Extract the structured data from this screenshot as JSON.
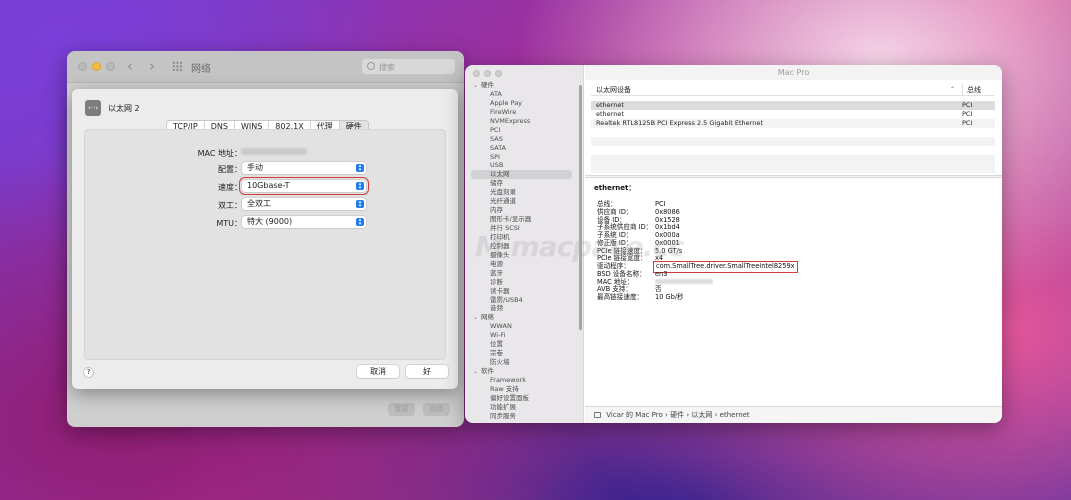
{
  "network_window": {
    "title": "网络",
    "search_placeholder": "搜索",
    "bottom_buttons": {
      "revert": "复原",
      "apply": "应用"
    }
  },
  "sheet": {
    "service_name": "以太网 2",
    "service_icon": "ethernet-arrows-icon",
    "tabs": [
      "TCP/IP",
      "DNS",
      "WINS",
      "802.1X",
      "代理",
      "硬件"
    ],
    "active_tab": "硬件",
    "fields": {
      "mac_label": "MAC 地址：",
      "config_label": "配置：",
      "config_value": "手动",
      "speed_label": "速度：",
      "speed_value": "10Gbase-T",
      "duplex_label": "双工：",
      "duplex_value": "全双工",
      "mtu_label": "MTU：",
      "mtu_value": "特大 (9000)"
    },
    "help_label": "?",
    "cancel_label": "取消",
    "ok_label": "好"
  },
  "info_window": {
    "title": "Mac Pro",
    "sidebar": [
      {
        "label": "硬件",
        "type": "category"
      },
      {
        "label": "ATA",
        "type": "item"
      },
      {
        "label": "Apple Pay",
        "type": "item"
      },
      {
        "label": "FireWire",
        "type": "item"
      },
      {
        "label": "NVMExpress",
        "type": "item"
      },
      {
        "label": "PCI",
        "type": "item"
      },
      {
        "label": "SAS",
        "type": "item"
      },
      {
        "label": "SATA",
        "type": "item"
      },
      {
        "label": "SPI",
        "type": "item"
      },
      {
        "label": "USB",
        "type": "item"
      },
      {
        "label": "以太网",
        "type": "item",
        "selected": true
      },
      {
        "label": "储存",
        "type": "item"
      },
      {
        "label": "光盘刻录",
        "type": "item"
      },
      {
        "label": "光纤通道",
        "type": "item"
      },
      {
        "label": "内存",
        "type": "item"
      },
      {
        "label": "图形卡/显示器",
        "type": "item"
      },
      {
        "label": "并行 SCSI",
        "type": "item"
      },
      {
        "label": "打印机",
        "type": "item"
      },
      {
        "label": "控制器",
        "type": "item"
      },
      {
        "label": "摄像头",
        "type": "item"
      },
      {
        "label": "电源",
        "type": "item"
      },
      {
        "label": "蓝牙",
        "type": "item"
      },
      {
        "label": "诊断",
        "type": "item"
      },
      {
        "label": "读卡器",
        "type": "item"
      },
      {
        "label": "雷雳/USB4",
        "type": "item"
      },
      {
        "label": "音频",
        "type": "item"
      },
      {
        "label": "网络",
        "type": "category"
      },
      {
        "label": "WWAN",
        "type": "item"
      },
      {
        "label": "Wi-Fi",
        "type": "item"
      },
      {
        "label": "位置",
        "type": "item"
      },
      {
        "label": "宗卷",
        "type": "item"
      },
      {
        "label": "防火墙",
        "type": "item"
      },
      {
        "label": "软件",
        "type": "category"
      },
      {
        "label": "Framework",
        "type": "item"
      },
      {
        "label": "Raw 支持",
        "type": "item"
      },
      {
        "label": "偏好设置面板",
        "type": "item"
      },
      {
        "label": "功能扩展",
        "type": "item"
      },
      {
        "label": "同步服务",
        "type": "item"
      }
    ],
    "device_table": {
      "headers": [
        "以太网设备",
        "总线"
      ],
      "rows": [
        [
          "ethernet",
          "PCI"
        ],
        [
          "ethernet",
          "PCI"
        ],
        [
          "Realtek RTL8125B PCI Express 2.5 Gigabit Ethernet",
          "PCI"
        ]
      ],
      "selected_row": 0
    },
    "detail": {
      "heading": "ethernet：",
      "rows": [
        [
          "总线：",
          "PCI"
        ],
        [
          "供应商 ID：",
          "0x8086"
        ],
        [
          "设备 ID：",
          "0x1528"
        ],
        [
          "子系统供应商 ID：",
          "0x1bd4"
        ],
        [
          "子系统 ID：",
          "0x000a"
        ],
        [
          "修正版 ID：",
          "0x0001"
        ],
        [
          "PCIe 链接速度：",
          "5.0 GT/s"
        ],
        [
          "PCIe 链接宽度：",
          "x4"
        ],
        [
          "驱动程序：",
          "com.SmallTree.driver.SmallTreeIntel8259x"
        ],
        [
          "BSD 设备名称：",
          "en3"
        ],
        [
          "MAC 地址：",
          ""
        ],
        [
          "AVB 支持：",
          "否"
        ],
        [
          "最高链接速度：",
          "10 Gb/秒"
        ]
      ]
    },
    "path": [
      "Vicar 的 Mac Pro",
      "硬件",
      "以太网",
      "ethernet"
    ],
    "path_separator": "›"
  },
  "colors": {
    "accent": "#1f7bf2",
    "highlight_box": "#d33c3c"
  }
}
